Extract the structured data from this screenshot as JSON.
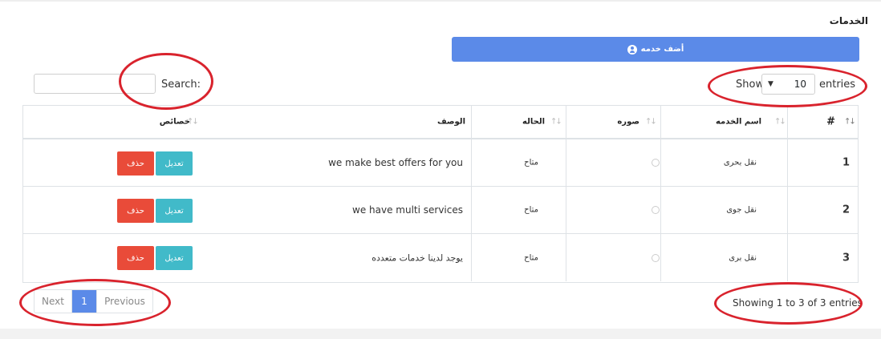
{
  "page": {
    "title": "الخدمات"
  },
  "add_button": {
    "label": "أضف خدمه",
    "icon": "user-circle-icon"
  },
  "search": {
    "label": "Search:",
    "value": ""
  },
  "length": {
    "show_label": "Show",
    "value": "10",
    "entries_label": "entries"
  },
  "table": {
    "headers": [
      "#",
      "اسم الخدمه",
      "صوره",
      "الحاله",
      "الوصف",
      "خصائص"
    ],
    "rows": [
      {
        "num": "1",
        "name": "نقل بحرى",
        "status": "متاح",
        "description": "we make best offers for you",
        "edit": "تعديل",
        "delete": "حذف"
      },
      {
        "num": "2",
        "name": "نقل جوى",
        "status": "متاح",
        "description": "we have multi services",
        "edit": "تعديل",
        "delete": "حذف"
      },
      {
        "num": "3",
        "name": "نقل برى",
        "status": "متاح",
        "description": "يوجد لدينا خدمات متعدده",
        "edit": "تعديل",
        "delete": "حذف"
      }
    ]
  },
  "pagination": {
    "next": "Next",
    "current": "1",
    "previous": "Previous"
  },
  "info": "Showing 1 to 3 of 3 entries",
  "colors": {
    "primary": "#5b8ae8",
    "edit": "#41bac9",
    "delete": "#e94b39",
    "annotation": "#d9232d"
  }
}
